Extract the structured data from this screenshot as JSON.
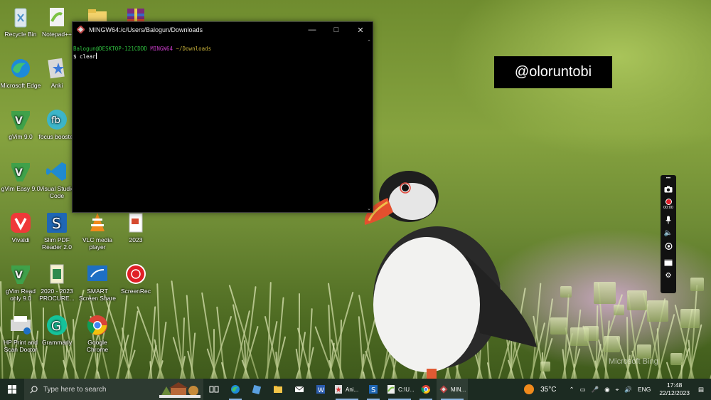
{
  "desktop": {
    "icons": [
      {
        "label": "Recycle Bin",
        "icon": "recycle-bin-icon"
      },
      {
        "label": "Notepad++",
        "icon": "notepad-plus-plus-icon"
      },
      {
        "label": "",
        "icon": "folder-icon"
      },
      {
        "label": "",
        "icon": "winrar-icon"
      },
      {
        "label": "Microsoft Edge",
        "icon": "edge-icon"
      },
      {
        "label": "Anki",
        "icon": "anki-icon"
      },
      {
        "label": "gVim 9.0",
        "icon": "gvim-icon"
      },
      {
        "label": "focus booster",
        "icon": "focus-booster-icon"
      },
      {
        "label": "gVim Easy 9.0",
        "icon": "gvim-icon"
      },
      {
        "label": "Visual Studio Code",
        "icon": "vscode-icon"
      },
      {
        "label": "Vivaldi",
        "icon": "vivaldi-icon"
      },
      {
        "label": "Slim PDF Reader 2.0",
        "icon": "slim-pdf-icon"
      },
      {
        "label": "VLC media player",
        "icon": "vlc-icon"
      },
      {
        "label": "2023",
        "icon": "document-icon"
      },
      {
        "label": "gVim Read only 9.0",
        "icon": "gvim-icon"
      },
      {
        "label": "2020 - 2023 PROCURE...",
        "icon": "excel-file-icon"
      },
      {
        "label": "SMART Screen Share",
        "icon": "screen-share-icon"
      },
      {
        "label": "ScreenRec",
        "icon": "screenrec-icon"
      },
      {
        "label": "HP Print and Scan Doctor",
        "icon": "hp-print-icon"
      },
      {
        "label": "Grammarly",
        "icon": "grammarly-icon"
      },
      {
        "label": "Google Chrome",
        "icon": "chrome-icon"
      }
    ],
    "watermark": "Microsoft Bing"
  },
  "terminal": {
    "title": "MINGW64:/c/Users/Balogun/Downloads",
    "prompt_user": "Balogun@DESKTOP-121CDDD",
    "prompt_system": "MINGW64",
    "prompt_path": "~/Downloads",
    "command": "$ clear"
  },
  "overlay": {
    "handle": "@oloruntobi",
    "recorder_timer": "00:00"
  },
  "taskbar": {
    "search_placeholder": "Type here to search",
    "apps": [
      {
        "icon": "task-view-icon",
        "label": ""
      },
      {
        "icon": "edge-icon",
        "label": ""
      },
      {
        "icon": "file-icon",
        "label": ""
      },
      {
        "icon": "file-explorer-icon",
        "label": ""
      },
      {
        "icon": "mail-icon",
        "label": ""
      },
      {
        "icon": "word-icon",
        "label": ""
      },
      {
        "icon": "anki-icon",
        "label": "Ani..."
      },
      {
        "icon": "slim-pdf-icon",
        "label": ""
      },
      {
        "icon": "notepad-plus-plus-icon",
        "label": "C:\\U..."
      },
      {
        "icon": "chrome-icon",
        "label": ""
      },
      {
        "icon": "mingw-icon",
        "label": "MIN..."
      }
    ],
    "weather": "35°C",
    "language": "ENG",
    "time": "17:48",
    "date": "22/12/2023"
  }
}
